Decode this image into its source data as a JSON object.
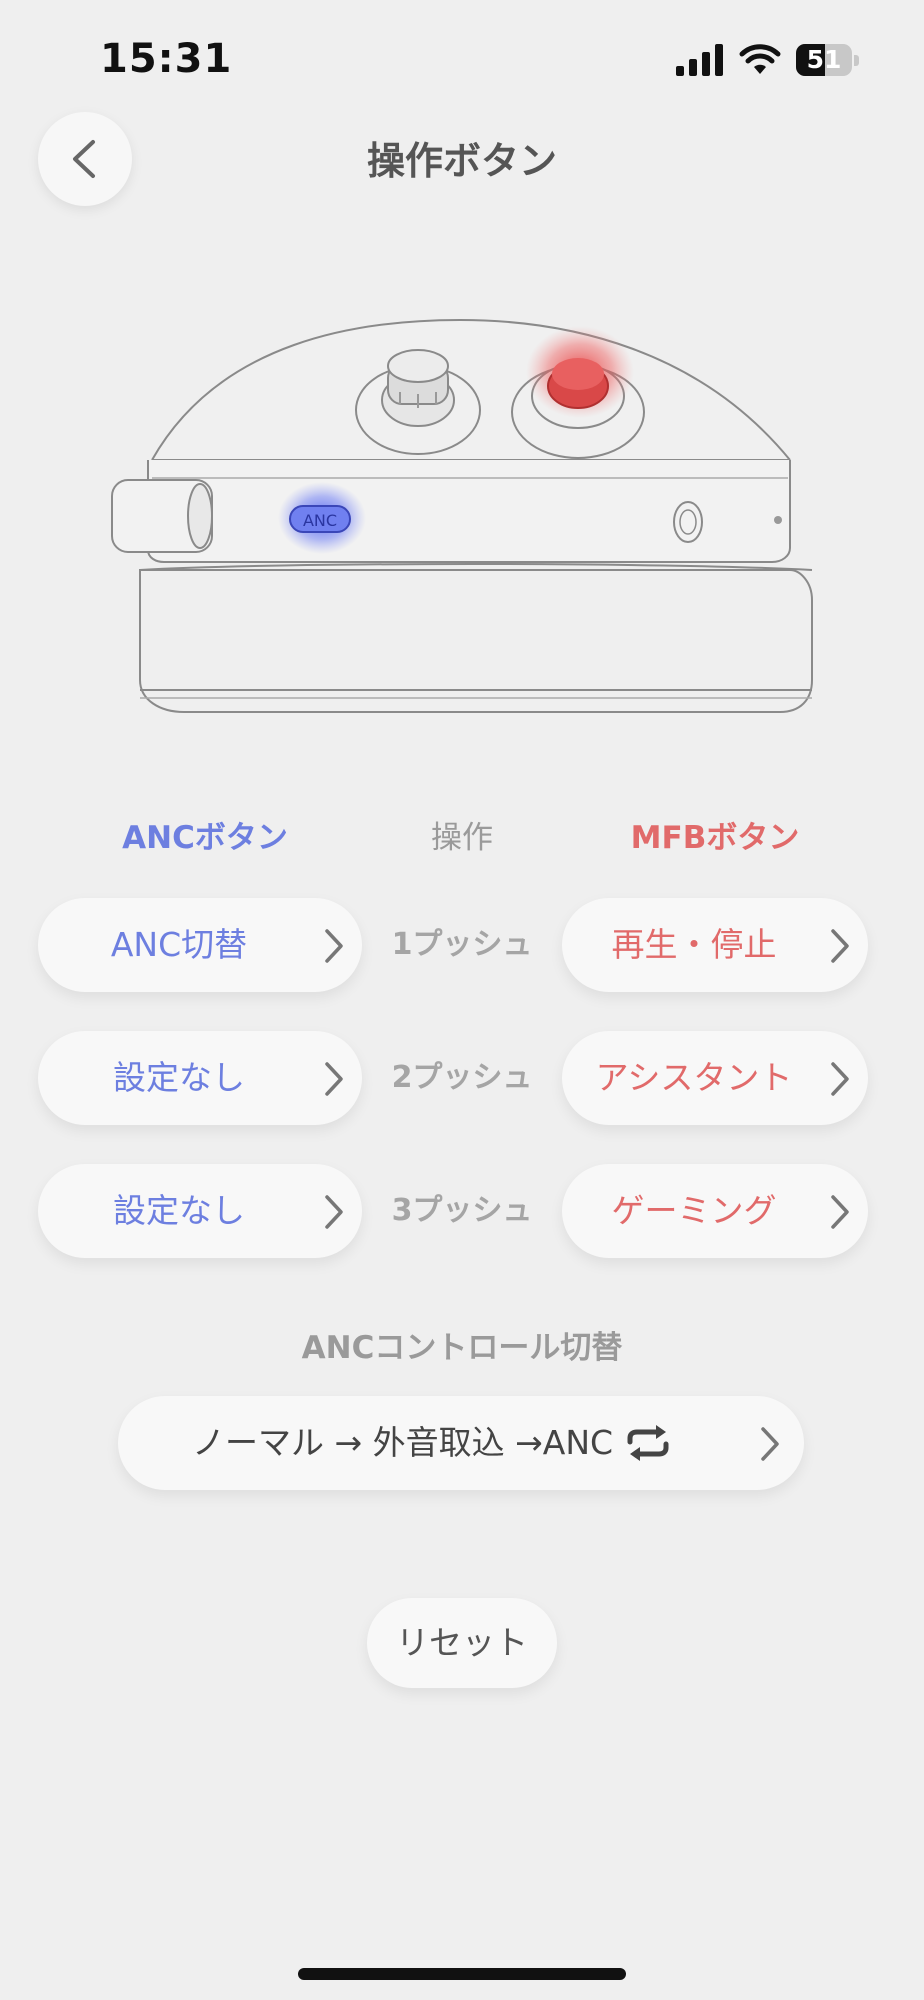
{
  "status_bar": {
    "time": "15:31",
    "battery_level": "51",
    "battery_fraction": 0.51
  },
  "header": {
    "back_icon": "chevron-left-icon",
    "title": "操作ボタン"
  },
  "illustration": {
    "anc_button_label": "ANC",
    "anc_highlight_color": "#4c5cf0",
    "mfb_highlight_color": "#ee4444"
  },
  "columns": {
    "anc": "ANCボタン",
    "operation": "操作",
    "mfb": "MFBボタン"
  },
  "rows": [
    {
      "operation": "1プッシュ",
      "anc_value": "ANC切替",
      "mfb_value": "再生・停止"
    },
    {
      "operation": "2プッシュ",
      "anc_value": "設定なし",
      "mfb_value": "アシスタント"
    },
    {
      "operation": "3プッシュ",
      "anc_value": "設定なし",
      "mfb_value": "ゲーミング"
    }
  ],
  "anc_control": {
    "title": "ANCコントロール切替",
    "value": "ノーマル → 外音取込 →ANC",
    "icon": "repeat-icon"
  },
  "reset_label": "リセット",
  "colors": {
    "anc_accent": "#6d7fe0",
    "mfb_accent": "#e16a6a",
    "background": "#efefef"
  }
}
